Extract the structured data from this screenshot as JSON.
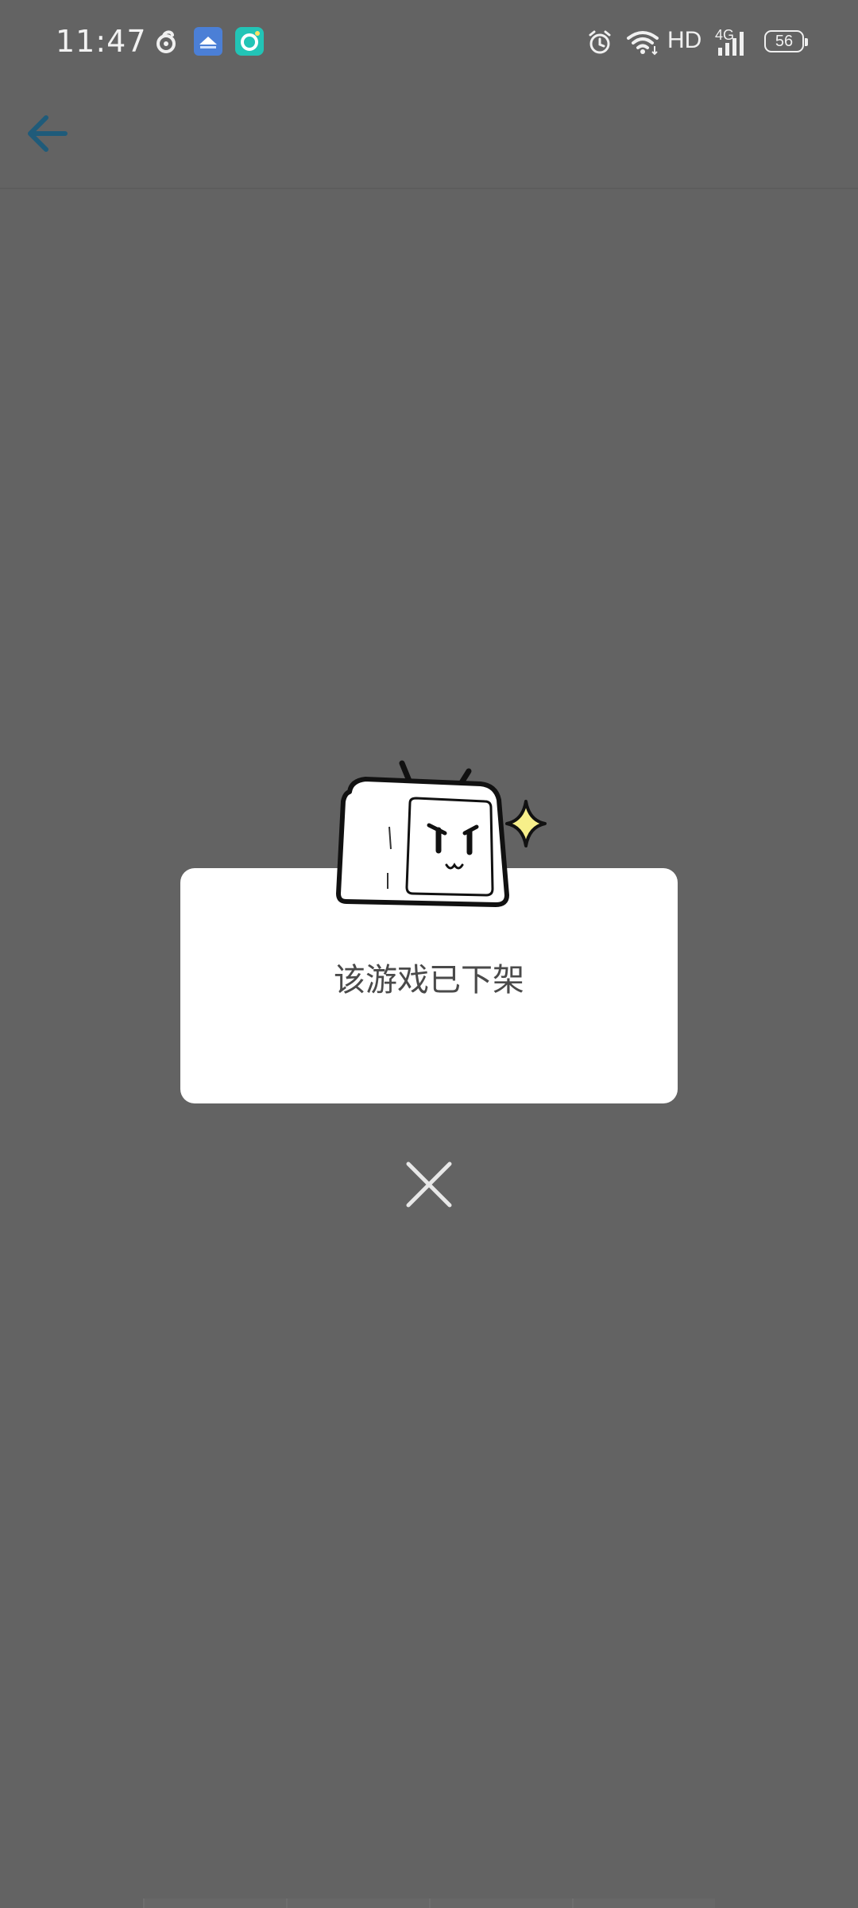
{
  "status_bar": {
    "time": "11:47",
    "left_icons": [
      "netease-music-icon",
      "cloud-drive-icon",
      "camera-app-icon"
    ],
    "right_icons": [
      "alarm-icon",
      "wifi-icon",
      "signal-icon",
      "battery-icon"
    ],
    "hd_label": "HD",
    "network_label": "4G",
    "battery_level": "56"
  },
  "header": {
    "back_icon": "arrow-left-icon",
    "accent_color": "#1f5b7a"
  },
  "dialog": {
    "message": "该游戏已下架",
    "mascot": "tv-mascot-illustration",
    "close_icon": "close-icon"
  },
  "colors": {
    "overlay_background": "#636363",
    "dialog_background": "#ffffff",
    "sparkle": "#f7ef8a"
  }
}
